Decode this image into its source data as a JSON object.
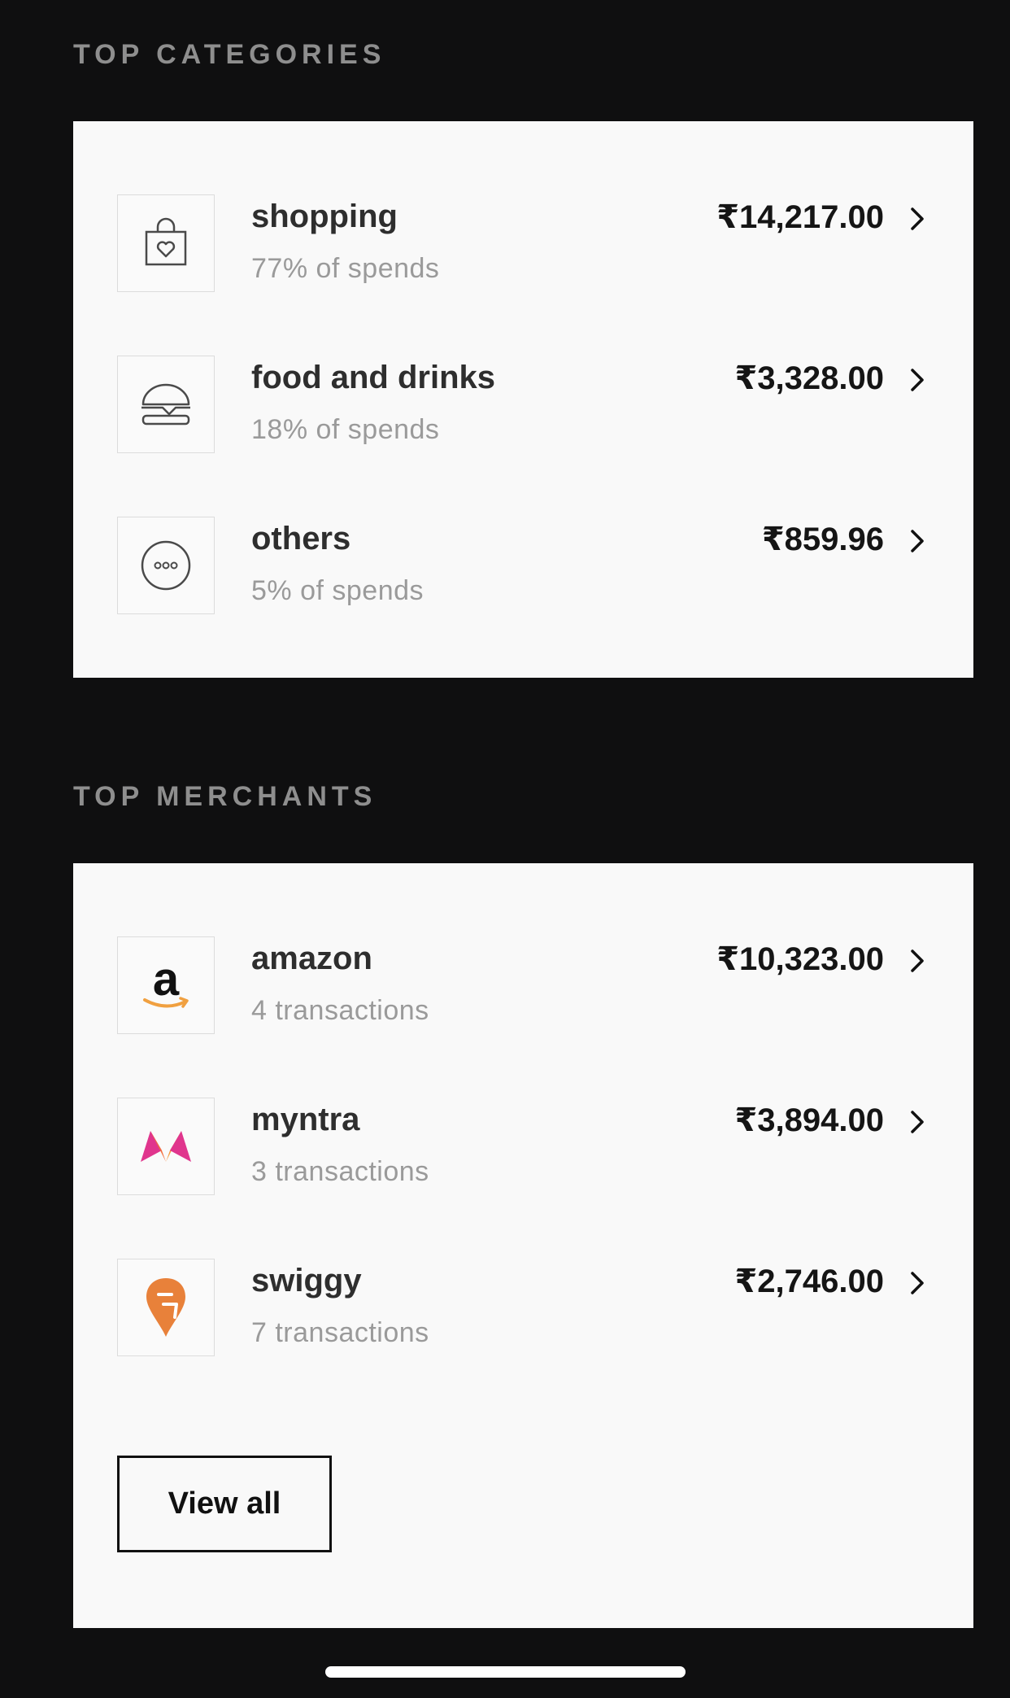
{
  "categories": {
    "title": "TOP CATEGORIES",
    "items": [
      {
        "name": "shopping",
        "subtitle": "77% of spends",
        "amount": "₹14,217.00",
        "icon": "shopping-bag-icon"
      },
      {
        "name": "food and drinks",
        "subtitle": "18% of spends",
        "amount": "₹3,328.00",
        "icon": "burger-icon"
      },
      {
        "name": "others",
        "subtitle": "5% of spends",
        "amount": "₹859.96",
        "icon": "more-dots-icon"
      }
    ]
  },
  "merchants": {
    "title": "TOP MERCHANTS",
    "items": [
      {
        "name": "amazon",
        "subtitle": "4 transactions",
        "amount": "₹10,323.00",
        "icon": "amazon-logo",
        "logo_text": "a"
      },
      {
        "name": "myntra",
        "subtitle": "3 transactions",
        "amount": "₹3,894.00",
        "icon": "myntra-logo"
      },
      {
        "name": "swiggy",
        "subtitle": "7 transactions",
        "amount": "₹2,746.00",
        "icon": "swiggy-logo"
      }
    ],
    "view_all_label": "View all"
  },
  "colors": {
    "background": "#0f0f10",
    "card": "#f9f9f9",
    "amazon_orange": "#f0a040",
    "myntra_pink": "#e0358d",
    "myntra_orange": "#f36f3e",
    "swiggy_orange": "#e8813a"
  }
}
